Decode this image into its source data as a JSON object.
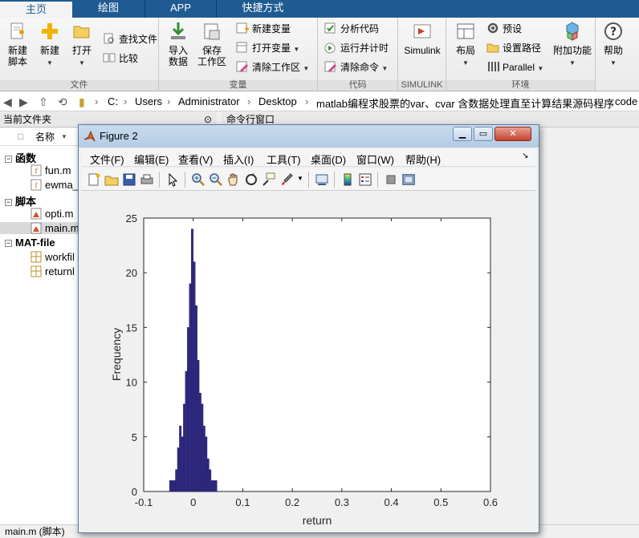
{
  "tabs": [
    "主页",
    "绘图",
    "APP",
    "快捷方式"
  ],
  "ribbon": {
    "file_group": {
      "label": "文件",
      "new_script": "新建\n脚本",
      "new_script_l1": "新建",
      "new_script_l2": "脚本",
      "new": "新建",
      "open": "打开",
      "find_files": "查找文件",
      "compare": "比较"
    },
    "variable_group": {
      "label": "变量",
      "import_l1": "导入",
      "import_l2": "数据",
      "save_l1": "保存",
      "save_l2": "工作区",
      "new_var": "新建变量",
      "open_var": "打开变量",
      "clear_ws": "清除工作区"
    },
    "code_group": {
      "label": "代码",
      "analyze": "分析代码",
      "run_time": "运行并计时",
      "clear_cmd": "清除命令"
    },
    "simulink_group": {
      "label": "SIMULINK",
      "simulink": "Simulink"
    },
    "env_group": {
      "label": "环境",
      "layout": "布局",
      "prefs": "预设",
      "set_path": "设置路径",
      "parallel": "Parallel",
      "addons": "附加功能"
    },
    "help": "帮助"
  },
  "address": {
    "crumbs": [
      "C:",
      "Users",
      "Administrator",
      "Desktop",
      "matlab编程求股票的var、cvar 含数据处理直至计算结果源码程序",
      "code"
    ]
  },
  "left_panel": {
    "title": "当前文件夹",
    "name_col": "名称",
    "groups": [
      {
        "label": "函数",
        "files": [
          "fun.m",
          "ewma_"
        ]
      },
      {
        "label": "脚本",
        "files": [
          "opti.m",
          "main.m"
        ]
      },
      {
        "label": "MAT-file",
        "files": [
          "workfil",
          "returnl"
        ]
      }
    ]
  },
  "command_window": {
    "title": "命令行窗口"
  },
  "status": {
    "text": "main.m  (脚本)"
  },
  "figure": {
    "title": "Figure 2",
    "menus": [
      "文件(F)",
      "编辑(E)",
      "查看(V)",
      "插入(I)",
      "工具(T)",
      "桌面(D)",
      "窗口(W)",
      "帮助(H)"
    ]
  },
  "chart_data": {
    "type": "bar",
    "xlabel": "return",
    "ylabel": "Frequency",
    "xlim": [
      -0.1,
      0.6
    ],
    "ylim": [
      0,
      25
    ],
    "xticks": [
      "-0.1",
      "0",
      "0.1",
      "0.2",
      "0.3",
      "0.4",
      "0.5",
      "0.6"
    ],
    "yticks": [
      "0",
      "5",
      "10",
      "15",
      "20",
      "25"
    ],
    "bar_color": "#312b82",
    "x": [
      -0.05,
      -0.046,
      -0.042,
      -0.038,
      -0.034,
      -0.03,
      -0.026,
      -0.022,
      -0.018,
      -0.014,
      -0.01,
      -0.006,
      -0.002,
      0.002,
      0.006,
      0.01,
      0.014,
      0.018,
      0.022,
      0.026,
      0.03,
      0.034,
      0.038,
      0.042,
      0.046
    ],
    "values": [
      0,
      1,
      1,
      1,
      2,
      4,
      6,
      5,
      8,
      11,
      15,
      19,
      24,
      21,
      17,
      12,
      9,
      8,
      6,
      5,
      3,
      2,
      1,
      1,
      1
    ]
  }
}
